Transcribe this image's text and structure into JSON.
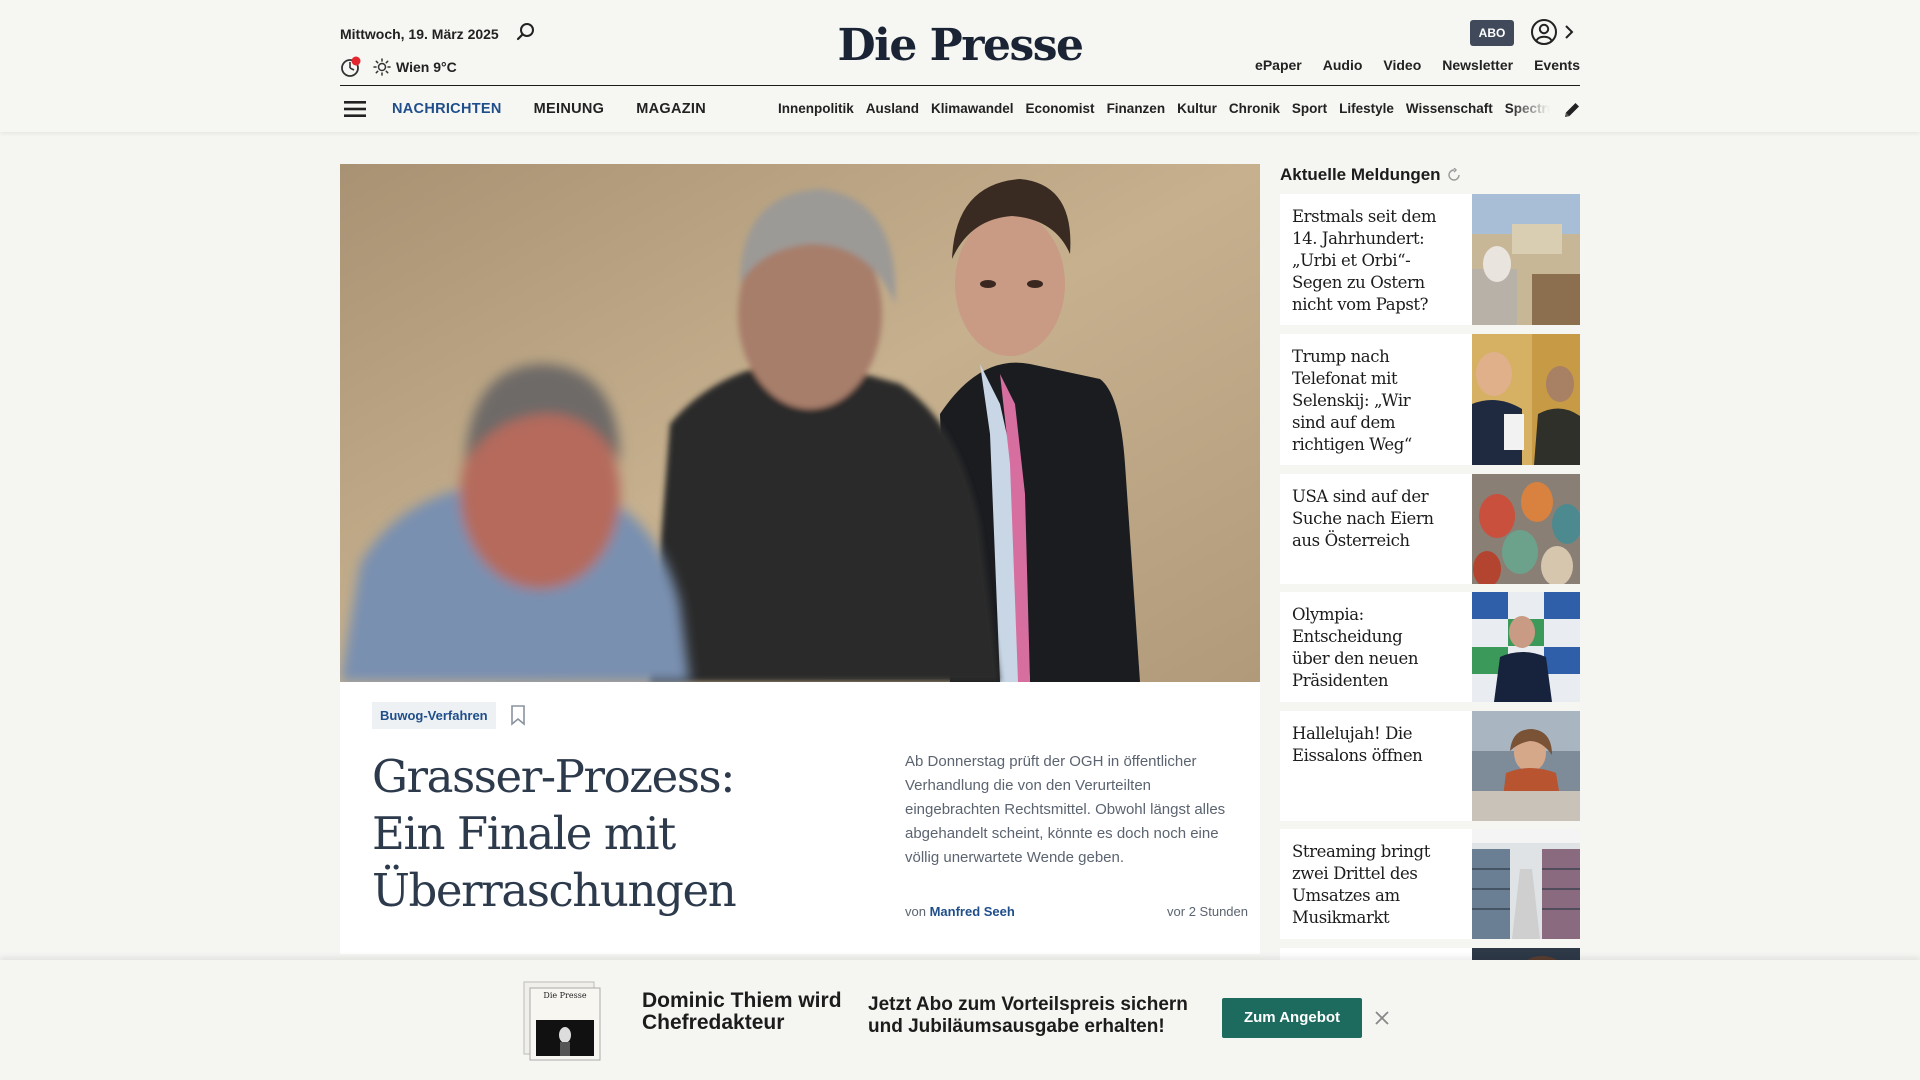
{
  "header": {
    "date": "Mittwoch, 19. März 2025",
    "weather": "Wien 9°C",
    "logo": "Die Presse",
    "abo_label": "ABO",
    "services": [
      "ePaper",
      "Audio",
      "Video",
      "Newsletter",
      "Events"
    ]
  },
  "nav": {
    "sections": [
      "NACHRICHTEN",
      "MEINUNG",
      "MAGAZIN"
    ],
    "active_section": "NACHRICHTEN",
    "subnav": [
      "Innenpolitik",
      "Ausland",
      "Klimawandel",
      "Economist",
      "Finanzen",
      "Kultur",
      "Chronik",
      "Sport",
      "Lifestyle",
      "Wissenschaft",
      "Spectrum"
    ]
  },
  "hero": {
    "tag": "Buwog-Verfahren",
    "headline": "Grasser-Prozess: Ein Finale mit Überraschungen",
    "teaser": "Ab Donnerstag prüft der OGH in öffentlicher Verhandlung die von den Verurteilten eingebrachten Rechtsmittel. Obwohl längst alles abgehandelt scheint, könnte es doch noch eine völlig unerwartete Wende geben.",
    "byline_prefix": "von",
    "author": "Manfred Seeh",
    "time": "vor 2 Stunden"
  },
  "sidebar": {
    "title": "Aktuelle Meldungen",
    "items": [
      {
        "title": "Erstmals seit dem 14. Jahrhundert: „Urbi et Orbi“-Segen zu Ostern nicht vom Papst?"
      },
      {
        "title": "Trump nach Telefonat mit Selenskij: „Wir sind auf dem richtigen Weg“"
      },
      {
        "title": "USA sind auf der Suche nach Eiern aus Österreich"
      },
      {
        "title": "Olympia: Entscheidung über den neuen Präsidenten"
      },
      {
        "title": "Hallelujah! Die Eissalons öffnen"
      },
      {
        "title": "Streaming bringt zwei Drittel des Umsatzes am Musikmarkt"
      }
    ]
  },
  "promo": {
    "name": "Dominic Thiem wird Chefredakteur",
    "text": "Jetzt Abo zum Vorteilspreis sichern und Jubiläumsausgabe erhalten!",
    "button": "Zum Angebot",
    "cover_label": "Die Presse"
  },
  "colors": {
    "brand_navy": "#1b2434",
    "link_blue": "#1f4e8a",
    "cta_green": "#1d6b5e",
    "live_red": "#e3262e"
  }
}
